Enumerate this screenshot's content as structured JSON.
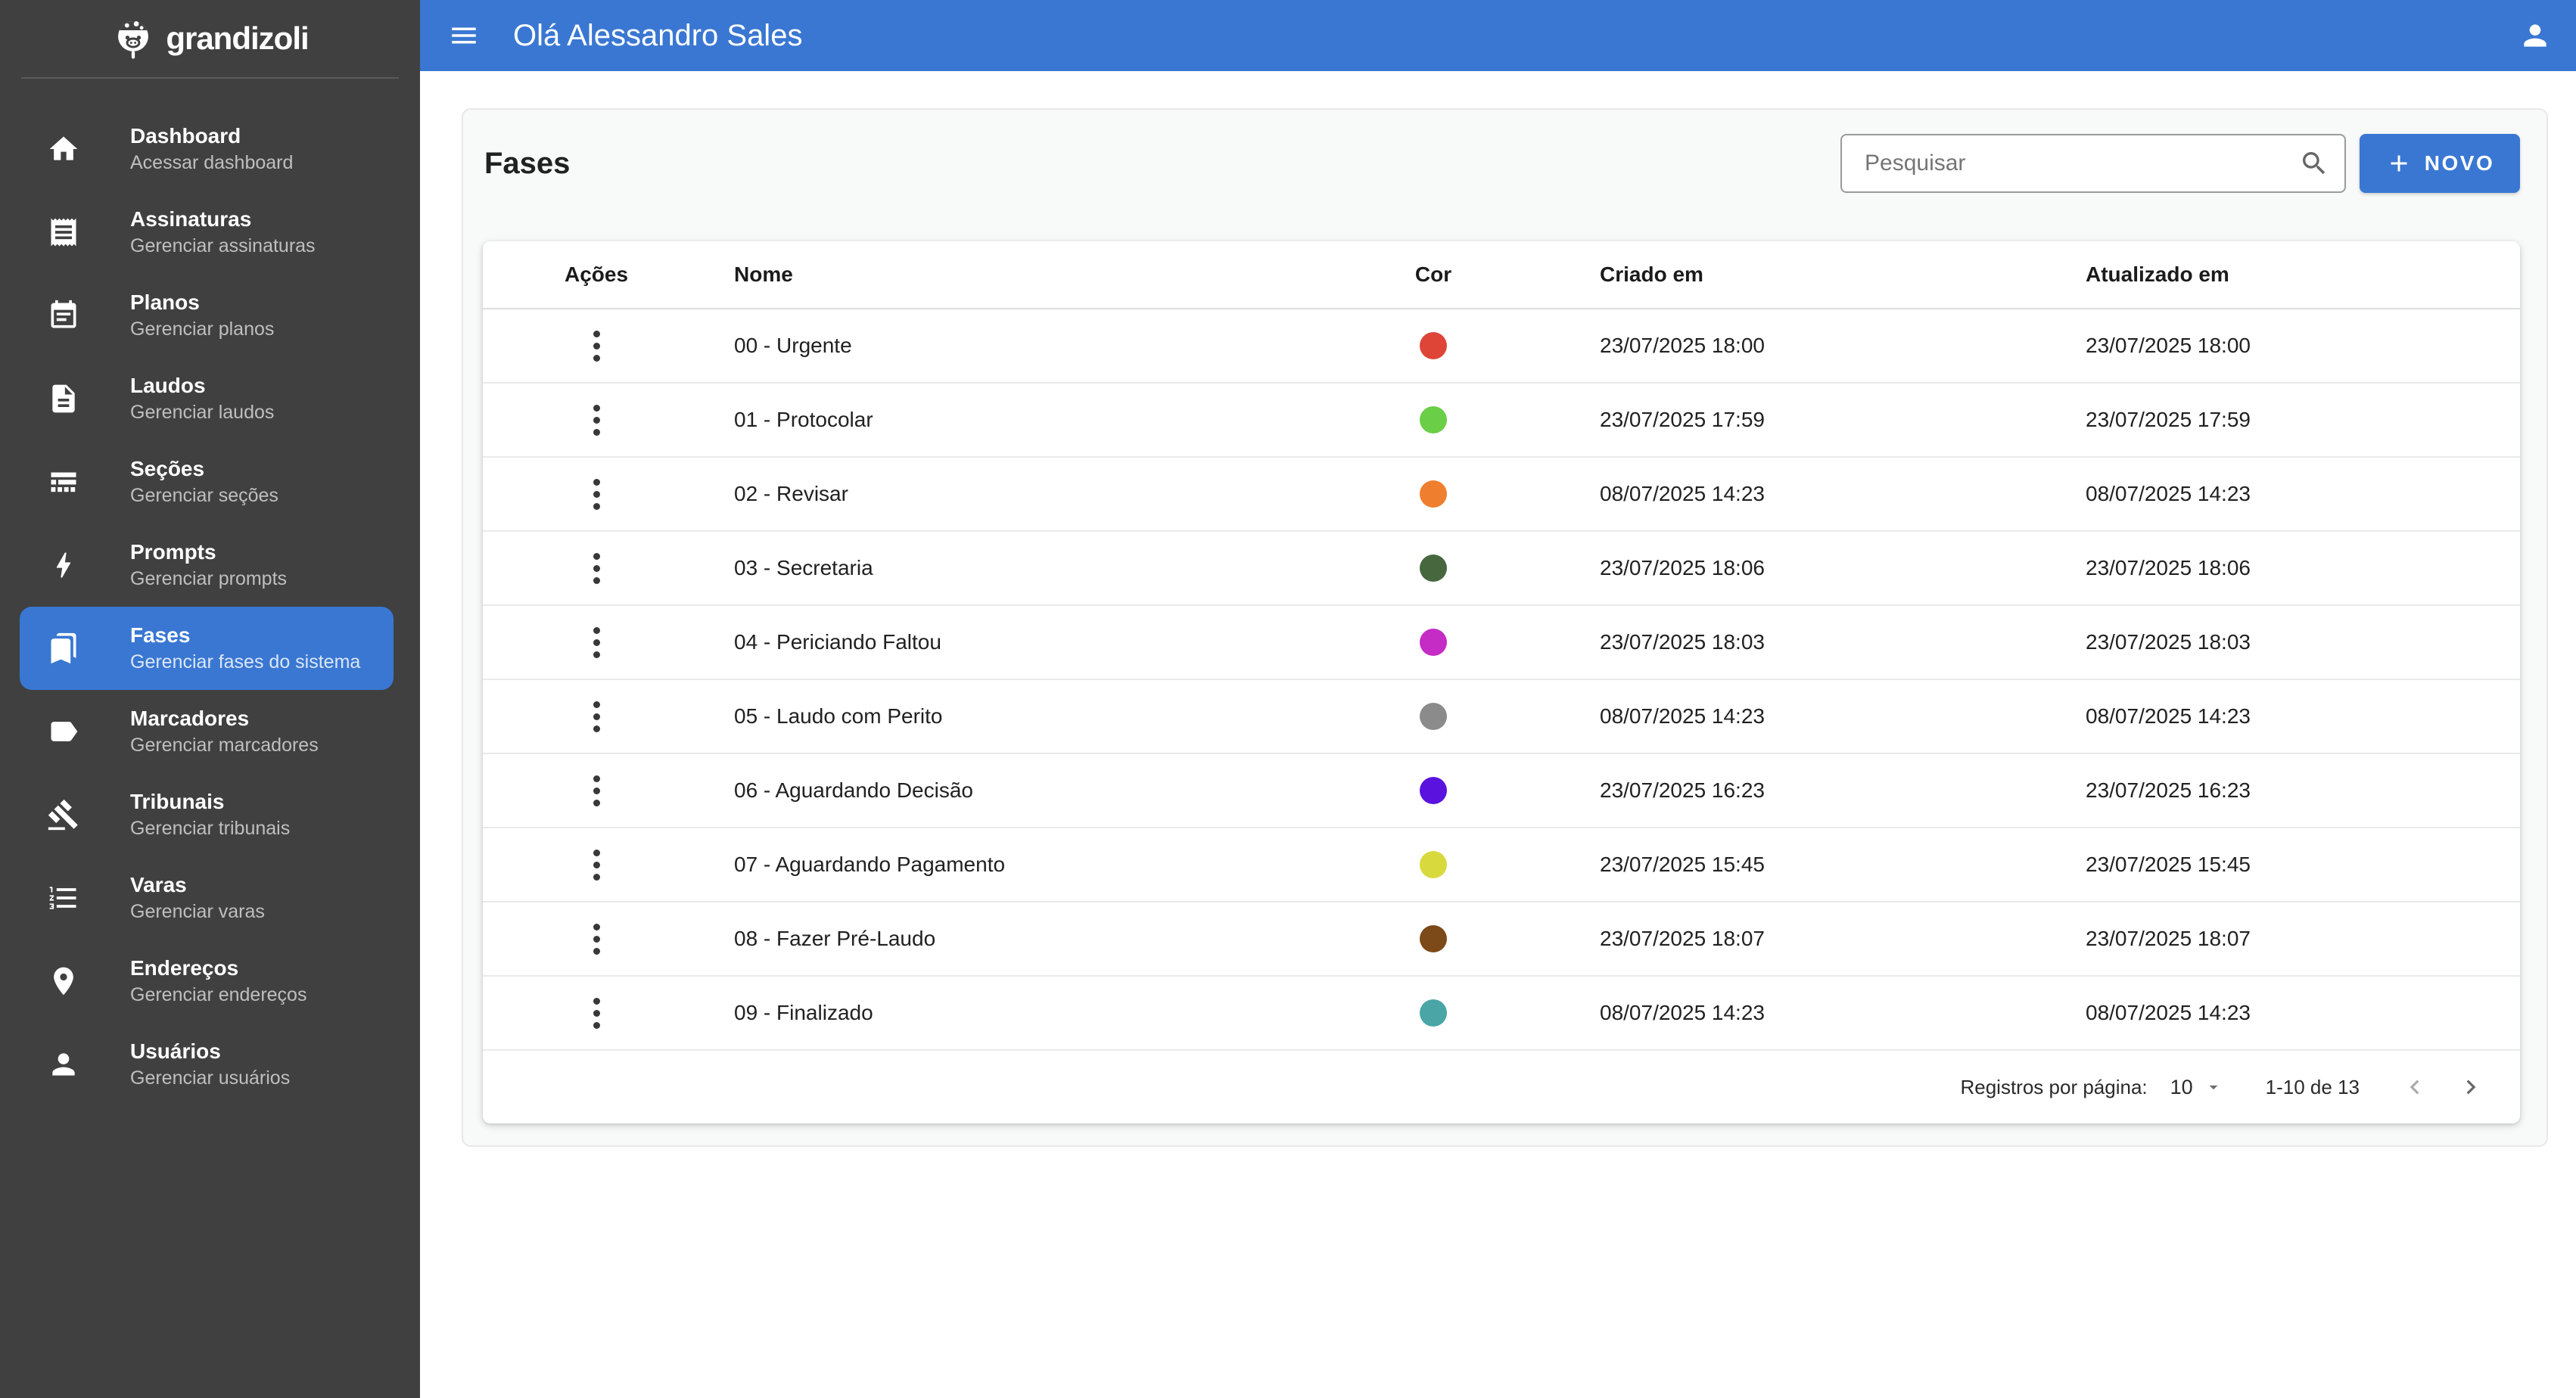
{
  "theme": {
    "accent": "#3977d2",
    "sidebar_bg": "#404040"
  },
  "brand": {
    "name": "grandizoli"
  },
  "header": {
    "greeting": "Olá Alessandro Sales"
  },
  "sidebar": {
    "items": [
      {
        "key": "dashboard",
        "label": "Dashboard",
        "sublabel": "Acessar dashboard",
        "icon": "home-icon",
        "active": false
      },
      {
        "key": "assinaturas",
        "label": "Assinaturas",
        "sublabel": "Gerenciar assinaturas",
        "icon": "receipt-icon",
        "active": false
      },
      {
        "key": "planos",
        "label": "Planos",
        "sublabel": "Gerenciar planos",
        "icon": "calendar-icon",
        "active": false
      },
      {
        "key": "laudos",
        "label": "Laudos",
        "sublabel": "Gerenciar laudos",
        "icon": "document-icon",
        "active": false
      },
      {
        "key": "secoes",
        "label": "Seções",
        "sublabel": "Gerenciar seções",
        "icon": "rows-icon",
        "active": false
      },
      {
        "key": "prompts",
        "label": "Prompts",
        "sublabel": "Gerenciar prompts",
        "icon": "bolt-icon",
        "active": false
      },
      {
        "key": "fases",
        "label": "Fases",
        "sublabel": "Gerenciar fases do sistema",
        "icon": "bookmarks-icon",
        "active": true
      },
      {
        "key": "marcadores",
        "label": "Marcadores",
        "sublabel": "Gerenciar marcadores",
        "icon": "label-icon",
        "active": false
      },
      {
        "key": "tribunais",
        "label": "Tribunais",
        "sublabel": "Gerenciar tribunais",
        "icon": "gavel-icon",
        "active": false
      },
      {
        "key": "varas",
        "label": "Varas",
        "sublabel": "Gerenciar varas",
        "icon": "numbered-list-icon",
        "active": false
      },
      {
        "key": "enderecos",
        "label": "Endereços",
        "sublabel": "Gerenciar endereços",
        "icon": "location-pin-icon",
        "active": false
      },
      {
        "key": "usuarios",
        "label": "Usuários",
        "sublabel": "Gerenciar usuários",
        "icon": "person-icon",
        "active": false
      }
    ]
  },
  "page": {
    "title": "Fases",
    "search_placeholder": "Pesquisar",
    "new_button": "NOVO"
  },
  "table": {
    "columns": [
      "Ações",
      "Nome",
      "Cor",
      "Criado em",
      "Atualizado em"
    ],
    "rows": [
      {
        "name": "00 - Urgente",
        "color": "#df4537",
        "created": "23/07/2025 18:00",
        "updated": "23/07/2025 18:00"
      },
      {
        "name": "01 - Protocolar",
        "color": "#6ace46",
        "created": "23/07/2025 17:59",
        "updated": "23/07/2025 17:59"
      },
      {
        "name": "02 - Revisar",
        "color": "#ef7e2e",
        "created": "08/07/2025 14:23",
        "updated": "08/07/2025 14:23"
      },
      {
        "name": "03 - Secretaria",
        "color": "#47683e",
        "created": "23/07/2025 18:06",
        "updated": "23/07/2025 18:06"
      },
      {
        "name": "04 - Periciando Faltou",
        "color": "#c52bc5",
        "created": "23/07/2025 18:03",
        "updated": "23/07/2025 18:03"
      },
      {
        "name": "05 - Laudo com Perito",
        "color": "#8b8b8b",
        "created": "08/07/2025 14:23",
        "updated": "08/07/2025 14:23"
      },
      {
        "name": "06 - Aguardando Decisão",
        "color": "#5a12df",
        "created": "23/07/2025 16:23",
        "updated": "23/07/2025 16:23"
      },
      {
        "name": "07 - Aguardando Pagamento",
        "color": "#d8d93d",
        "created": "23/07/2025 15:45",
        "updated": "23/07/2025 15:45"
      },
      {
        "name": "08 - Fazer Pré-Laudo",
        "color": "#7c4a18",
        "created": "23/07/2025 18:07",
        "updated": "23/07/2025 18:07"
      },
      {
        "name": "09 - Finalizado",
        "color": "#4aa5a6",
        "created": "08/07/2025 14:23",
        "updated": "08/07/2025 14:23"
      }
    ]
  },
  "pagination": {
    "label": "Registros por página:",
    "per_page": "10",
    "range": "1-10 de 13"
  }
}
